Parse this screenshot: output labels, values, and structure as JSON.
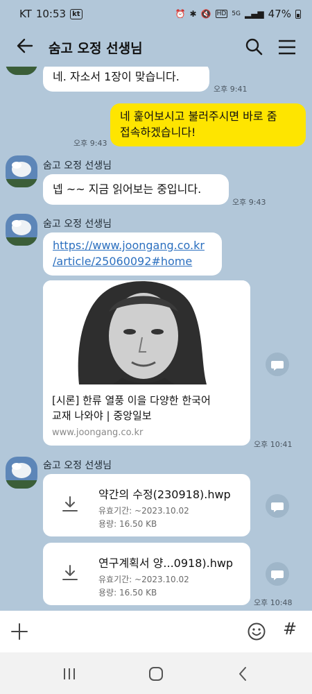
{
  "status_bar": {
    "carrier": "KT",
    "time": "10:53",
    "carrier_badge": "kt",
    "network_badge": "HD",
    "network_type": "5G",
    "battery": "47%"
  },
  "header": {
    "title": "숨고 오정 선생님"
  },
  "messages": {
    "m1_text": "네. 자소서 1장이 맞습니다.",
    "m1_time": "오후 9:41",
    "m2_line1": "네 훑어보시고 불러주시면 바로 줌",
    "m2_line2": "접속하겠습니다!",
    "m2_time": "오후 9:43",
    "sender_name": "숨고 오정 선생님",
    "m3_text": "넵 ~~  지금 읽어보는 중입니다.",
    "m3_time": "오후 9:43",
    "m4_link_line1": "https://www.joongang.co.kr",
    "m4_link_line2": "/article/25060092#home",
    "m4_card_title_line1": "[시론] 한류 열풍 이을 다양한 한국어",
    "m4_card_title_line2": "교재 나와야 | 중앙일보",
    "m4_card_domain": "www.joongang.co.kr",
    "m4_time": "오후 10:41",
    "file1_name": "약간의 수정(230918).hwp",
    "file1_expiry": "유효기간: ~2023.10.02",
    "file1_size": "용량: 16.50 KB",
    "file2_name": "연구계획서 양...0918).hwp",
    "file2_expiry": "유효기간: ~2023.10.02",
    "file2_size": "용량: 16.50 KB",
    "files_time": "오후 10:48"
  },
  "colors": {
    "chat_background": "#b2c7d9",
    "my_bubble": "#fee500",
    "their_bubble": "#ffffff",
    "link": "#2b6fbf"
  },
  "icons": [
    "back-arrow-icon",
    "search-icon",
    "menu-icon",
    "share-icon",
    "download-icon",
    "plus-icon",
    "emoji-icon",
    "hash-icon",
    "recents-icon",
    "home-icon",
    "back-icon"
  ]
}
